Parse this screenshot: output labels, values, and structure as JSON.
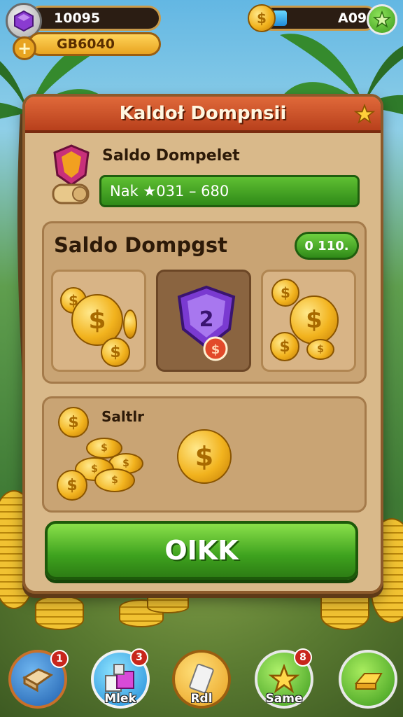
{
  "hud": {
    "gems_value": "10095",
    "gold_value": "GB6040",
    "energy_value": "A09",
    "energy_fill": 0.15
  },
  "panel": {
    "title": "Kaldoł Dompnsii",
    "balance_label": "Saldo Dompelet",
    "balance_bar": "Nak ★031 – 680",
    "rewards_title": "Saldo Dompgst",
    "rewards_count": "0 110.",
    "bonus_label": "Saltlr",
    "ok_label": "OIKK"
  },
  "nav": [
    {
      "label": "",
      "badge": "1",
      "icon": "crate-icon"
    },
    {
      "label": "Mlek",
      "badge": "3",
      "icon": "cubes-icon"
    },
    {
      "label": "Rdl",
      "badge": "",
      "icon": "card-icon"
    },
    {
      "label": "Same",
      "badge": "8",
      "icon": "star-icon"
    },
    {
      "label": "",
      "badge": "",
      "icon": "gold-bar-icon"
    }
  ],
  "colors": {
    "header": "#c8502a",
    "panel": "#d9b98a",
    "accent_green": "#3ea21e",
    "gold": "#f2b31e"
  }
}
